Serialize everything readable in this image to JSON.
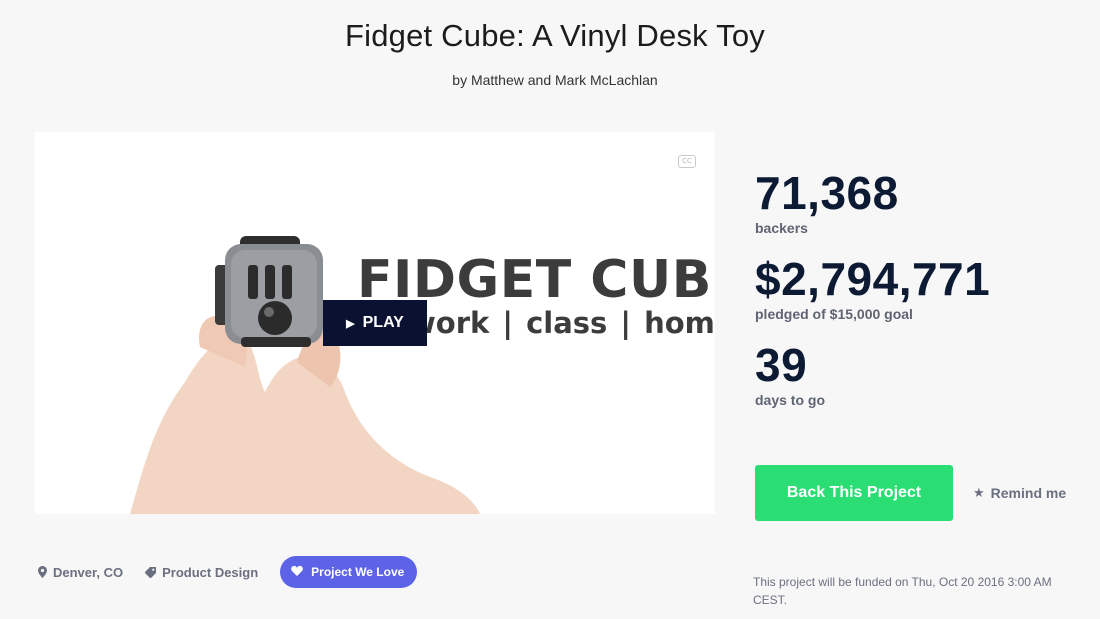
{
  "project": {
    "title": "Fidget Cube: A Vinyl Desk Toy",
    "byline": "by Matthew and Mark McLachlan"
  },
  "video": {
    "headline": "FIDGET CUBE",
    "tagline": "work | class | home",
    "play_label": "PLAY",
    "play_icon": "play-triangle-icon",
    "cc_label": "CC",
    "cc_icon": "closed-captions-icon"
  },
  "stats": {
    "backers": {
      "value": "71,368",
      "label": "backers"
    },
    "pledged": {
      "value": "$2,794,771",
      "label": "pledged of $15,000 goal"
    },
    "days": {
      "value": "39",
      "label": "days to go"
    }
  },
  "actions": {
    "back_label": "Back This Project",
    "remind_label": "Remind me",
    "remind_icon": "star-icon"
  },
  "meta": {
    "location": "Denver, CO",
    "location_icon": "map-pin-icon",
    "category": "Product Design",
    "category_icon": "tag-icon",
    "badge": "Project We Love",
    "badge_icon": "heart-icon"
  },
  "funding_note": "This project will be funded on Thu, Oct 20 2016 3:00 AM CEST.",
  "colors": {
    "background": "#f7f7f8",
    "stat_number": "#0c1a33",
    "back_button": "#2bde73",
    "play_button": "#0b1130",
    "badge": "#5d63e6",
    "muted_text": "#6b7080"
  }
}
